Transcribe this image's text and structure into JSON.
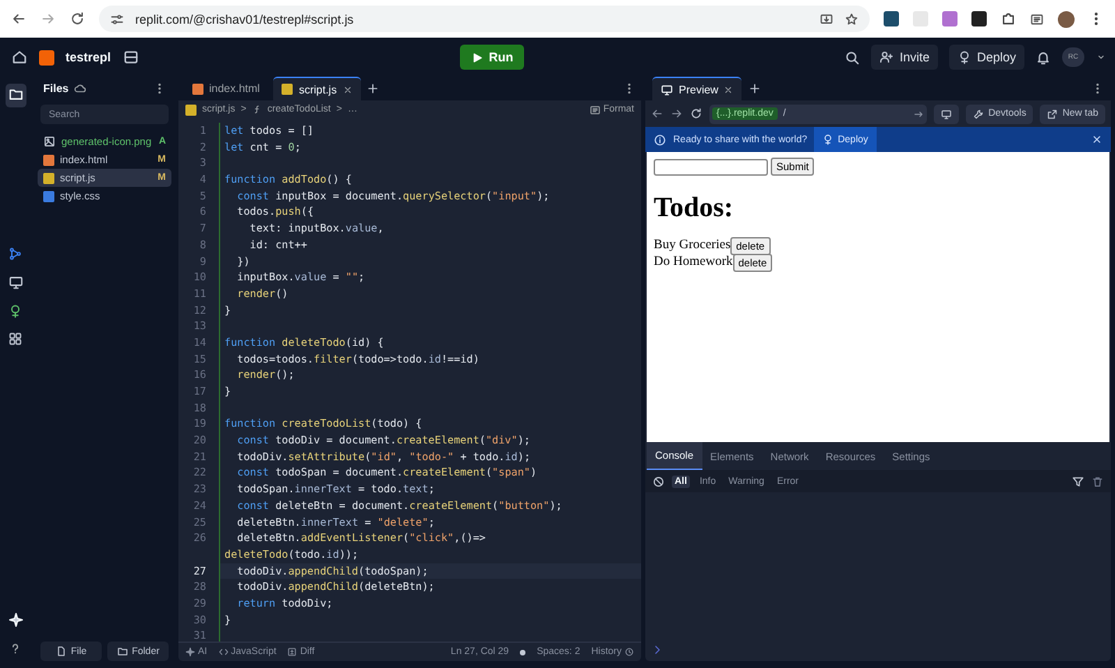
{
  "browser": {
    "url": "replit.com/@crishav01/testrepl#script.js"
  },
  "topbar": {
    "project": "testrepl",
    "run": "Run",
    "invite": "Invite",
    "deploy": "Deploy",
    "avatar": "RC"
  },
  "files": {
    "title": "Files",
    "search_placeholder": "Search",
    "items": [
      {
        "name": "generated-icon.png",
        "kind": "image",
        "added": true,
        "badge": "A",
        "selected": false
      },
      {
        "name": "index.html",
        "kind": "html",
        "added": false,
        "badge": "M",
        "selected": false
      },
      {
        "name": "script.js",
        "kind": "js",
        "added": false,
        "badge": "M",
        "selected": true
      },
      {
        "name": "style.css",
        "kind": "css",
        "added": false,
        "selected": false
      }
    ],
    "buttons": [
      {
        "label": "File",
        "kind": "file"
      },
      {
        "label": "Folder",
        "kind": "folder"
      }
    ]
  },
  "editor": {
    "tabs": [
      {
        "label": "index.html",
        "kind": "html",
        "selected": false
      },
      {
        "label": "script.js",
        "kind": "js",
        "selected": true
      }
    ],
    "breadcrumb": [
      "script.js",
      ">",
      "createTodoList",
      ">",
      "…"
    ],
    "format": "Format",
    "lines": [
      {
        "number": "1",
        "tokens": [
          {
            "kind": "kw",
            "text": "let"
          },
          {
            "kind": "plain",
            "text": " todos = []"
          }
        ]
      },
      {
        "number": "2",
        "tokens": [
          {
            "kind": "kw",
            "text": "let"
          },
          {
            "kind": "plain",
            "text": " cnt = "
          },
          {
            "kind": "num",
            "text": "0"
          },
          {
            "kind": "plain",
            "text": ";"
          }
        ]
      },
      {
        "number": "3"
      },
      {
        "number": "4",
        "tokens": [
          {
            "kind": "kw",
            "text": "function "
          },
          {
            "kind": "fn",
            "text": "addTodo"
          },
          {
            "kind": "plain",
            "text": "() {"
          }
        ]
      },
      {
        "number": "5",
        "tokens": [
          {
            "kind": "kw",
            "text": "  const"
          },
          {
            "kind": "plain",
            "text": " inputBox = document."
          },
          {
            "kind": "fn",
            "text": "querySelector"
          },
          {
            "kind": "plain",
            "text": "("
          },
          {
            "kind": "str",
            "text": "\"input\""
          },
          {
            "kind": "plain",
            "text": ");"
          }
        ]
      },
      {
        "number": "6",
        "tokens": [
          {
            "kind": "plain",
            "text": "  todos."
          },
          {
            "kind": "fn",
            "text": "push"
          },
          {
            "kind": "plain",
            "text": "({"
          }
        ]
      },
      {
        "number": "7",
        "tokens": [
          {
            "kind": "plain",
            "text": "    text: inputBox."
          },
          {
            "kind": "prop",
            "text": "value"
          },
          {
            "kind": "plain",
            "text": ","
          }
        ]
      },
      {
        "number": "8",
        "tokens": [
          {
            "kind": "plain",
            "text": "    id: cnt++"
          }
        ]
      },
      {
        "number": "9",
        "tokens": [
          {
            "kind": "plain",
            "text": "  })"
          }
        ]
      },
      {
        "number": "10",
        "tokens": [
          {
            "kind": "plain",
            "text": "  inputBox."
          },
          {
            "kind": "prop",
            "text": "value"
          },
          {
            "kind": "plain",
            "text": " = "
          },
          {
            "kind": "str",
            "text": "\"\""
          },
          {
            "kind": "plain",
            "text": ";"
          }
        ]
      },
      {
        "number": "11",
        "tokens": [
          {
            "kind": "fn",
            "text": "  render"
          },
          {
            "kind": "plain",
            "text": "()"
          }
        ]
      },
      {
        "number": "12",
        "tokens": [
          {
            "kind": "plain",
            "text": "}"
          }
        ]
      },
      {
        "number": "13"
      },
      {
        "number": "14",
        "tokens": [
          {
            "kind": "kw",
            "text": "function "
          },
          {
            "kind": "fn",
            "text": "deleteTodo"
          },
          {
            "kind": "plain",
            "text": "(id) {"
          }
        ]
      },
      {
        "number": "15",
        "tokens": [
          {
            "kind": "plain",
            "text": "  todos=todos."
          },
          {
            "kind": "fn",
            "text": "filter"
          },
          {
            "kind": "plain",
            "text": "(todo=>todo."
          },
          {
            "kind": "prop",
            "text": "id"
          },
          {
            "kind": "plain",
            "text": "!==id)"
          }
        ]
      },
      {
        "number": "16",
        "tokens": [
          {
            "kind": "fn",
            "text": "  render"
          },
          {
            "kind": "plain",
            "text": "();"
          }
        ]
      },
      {
        "number": "17",
        "tokens": [
          {
            "kind": "plain",
            "text": "}"
          }
        ]
      },
      {
        "number": "18"
      },
      {
        "number": "19",
        "tokens": [
          {
            "kind": "kw",
            "text": "function "
          },
          {
            "kind": "fn",
            "text": "createTodoList"
          },
          {
            "kind": "plain",
            "text": "(todo) {"
          }
        ]
      },
      {
        "number": "20",
        "tokens": [
          {
            "kind": "kw",
            "text": "  const"
          },
          {
            "kind": "plain",
            "text": " todoDiv = document."
          },
          {
            "kind": "fn",
            "text": "createElement"
          },
          {
            "kind": "plain",
            "text": "("
          },
          {
            "kind": "str",
            "text": "\"div\""
          },
          {
            "kind": "plain",
            "text": ");"
          }
        ]
      },
      {
        "number": "21",
        "tokens": [
          {
            "kind": "plain",
            "text": "  todoDiv."
          },
          {
            "kind": "fn",
            "text": "setAttribute"
          },
          {
            "kind": "plain",
            "text": "("
          },
          {
            "kind": "str",
            "text": "\"id\""
          },
          {
            "kind": "plain",
            "text": ", "
          },
          {
            "kind": "str",
            "text": "\"todo-\""
          },
          {
            "kind": "plain",
            "text": " + todo."
          },
          {
            "kind": "prop",
            "text": "id"
          },
          {
            "kind": "plain",
            "text": ");"
          }
        ]
      },
      {
        "number": "22",
        "tokens": [
          {
            "kind": "kw",
            "text": "  const"
          },
          {
            "kind": "plain",
            "text": " todoSpan = document."
          },
          {
            "kind": "fn",
            "text": "createElement"
          },
          {
            "kind": "plain",
            "text": "("
          },
          {
            "kind": "str",
            "text": "\"span\""
          },
          {
            "kind": "plain",
            "text": ")"
          }
        ]
      },
      {
        "number": "23",
        "tokens": [
          {
            "kind": "plain",
            "text": "  todoSpan."
          },
          {
            "kind": "prop",
            "text": "innerText"
          },
          {
            "kind": "plain",
            "text": " = todo."
          },
          {
            "kind": "prop",
            "text": "text"
          },
          {
            "kind": "plain",
            "text": ";"
          }
        ]
      },
      {
        "number": "24",
        "tokens": [
          {
            "kind": "kw",
            "text": "  const"
          },
          {
            "kind": "plain",
            "text": " deleteBtn = document."
          },
          {
            "kind": "fn",
            "text": "createElement"
          },
          {
            "kind": "plain",
            "text": "("
          },
          {
            "kind": "str",
            "text": "\"button\""
          },
          {
            "kind": "plain",
            "text": ");"
          }
        ]
      },
      {
        "number": "25",
        "tokens": [
          {
            "kind": "plain",
            "text": "  deleteBtn."
          },
          {
            "kind": "prop",
            "text": "innerText"
          },
          {
            "kind": "plain",
            "text": " = "
          },
          {
            "kind": "str",
            "text": "\"delete\""
          },
          {
            "kind": "plain",
            "text": ";"
          }
        ]
      },
      {
        "number": "26",
        "tokens": [
          {
            "kind": "plain",
            "text": "  deleteBtn."
          },
          {
            "kind": "fn",
            "text": "addEventListener"
          },
          {
            "kind": "plain",
            "text": "("
          },
          {
            "kind": "str",
            "text": "\"click\""
          },
          {
            "kind": "plain",
            "text": ",()=>"
          }
        ],
        "wrap": [
          {
            "kind": "fn",
            "text": "deleteTodo"
          },
          {
            "kind": "plain",
            "text": "(todo."
          },
          {
            "kind": "prop",
            "text": "id"
          },
          {
            "kind": "plain",
            "text": "));"
          }
        ]
      },
      {
        "number": "27",
        "current": true,
        "tokens": [
          {
            "kind": "plain",
            "text": "  todoDiv."
          },
          {
            "kind": "fn",
            "text": "appendChild"
          },
          {
            "kind": "plain",
            "text": "(todoSpan);"
          }
        ]
      },
      {
        "number": "28",
        "tokens": [
          {
            "kind": "plain",
            "text": "  todoDiv."
          },
          {
            "kind": "fn",
            "text": "appendChild"
          },
          {
            "kind": "plain",
            "text": "(deleteBtn);"
          }
        ]
      },
      {
        "number": "29",
        "tokens": [
          {
            "kind": "kw",
            "text": "  return"
          },
          {
            "kind": "plain",
            "text": " todoDiv;"
          }
        ]
      },
      {
        "number": "30",
        "tokens": [
          {
            "kind": "plain",
            "text": "}"
          }
        ]
      },
      {
        "number": "31"
      }
    ],
    "status": {
      "ai": "AI",
      "language": "JavaScript",
      "diff": "Diff",
      "position": "Ln 27, Col 29",
      "spaces": "Spaces: 2",
      "history": "History"
    }
  },
  "preview": {
    "tab": "Preview",
    "url_host": "{...}.replit.dev",
    "url_path": "/",
    "devtools": "Devtools",
    "new_tab": "New tab",
    "banner": {
      "text": "Ready to share with the world?",
      "button": "Deploy"
    },
    "page": {
      "submit": "Submit",
      "heading": "Todos:",
      "items": [
        {
          "text": "Buy Groceries",
          "button": "delete"
        },
        {
          "text": "Do Homework",
          "button": "delete"
        }
      ]
    },
    "devtools_tabs": [
      {
        "label": "Console",
        "selected": true
      },
      {
        "label": "Elements",
        "selected": false
      },
      {
        "label": "Network",
        "selected": false
      },
      {
        "label": "Resources",
        "selected": false
      },
      {
        "label": "Settings",
        "selected": false
      }
    ],
    "filters": [
      {
        "label": "All",
        "selected": true
      },
      {
        "label": "Info",
        "selected": false
      },
      {
        "label": "Warning",
        "selected": false
      },
      {
        "label": "Error",
        "selected": false
      }
    ]
  }
}
